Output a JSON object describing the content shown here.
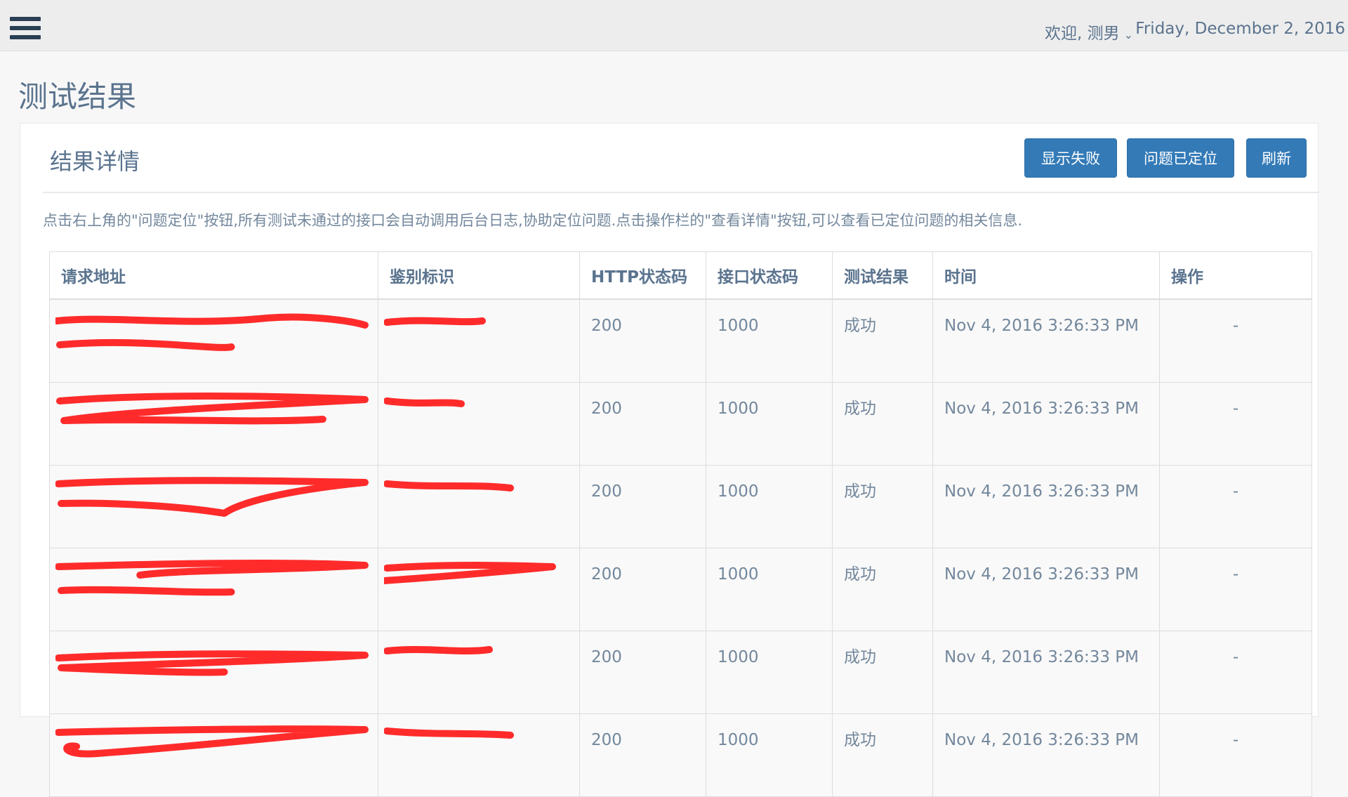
{
  "topbar": {
    "user_label": "欢迎, 测男",
    "date": "Friday, December 2, 2016"
  },
  "page_title": "测试结果",
  "panel": {
    "title": "结果详情",
    "buttons": {
      "show_failed": "显示失败",
      "issue_located": "问题已定位",
      "refresh": "刷新"
    },
    "instruction": "点击右上角的\"问题定位\"按钮,所有测试未通过的接口会自动调用后台日志,协助定位问题.点击操作栏的\"查看详情\"按钮,可以查看已定位问题的相关信息."
  },
  "table": {
    "headers": [
      "请求地址",
      "鉴别标识",
      "HTTP状态码",
      "接口状态码",
      "测试结果",
      "时间",
      "操作"
    ],
    "rows": [
      {
        "http": "200",
        "code": "1000",
        "result": "成功",
        "time": "Nov 4, 2016 3:26:33 PM",
        "op": "-"
      },
      {
        "http": "200",
        "code": "1000",
        "result": "成功",
        "time": "Nov 4, 2016 3:26:33 PM",
        "op": "-"
      },
      {
        "http": "200",
        "code": "1000",
        "result": "成功",
        "time": "Nov 4, 2016 3:26:33 PM",
        "op": "-"
      },
      {
        "http": "200",
        "code": "1000",
        "result": "成功",
        "time": "Nov 4, 2016 3:26:33 PM",
        "op": "-"
      },
      {
        "http": "200",
        "code": "1000",
        "result": "成功",
        "time": "Nov 4, 2016 3:26:33 PM",
        "op": "-"
      },
      {
        "http": "200",
        "code": "1000",
        "result": "成功",
        "time": "Nov 4, 2016 3:26:33 PM",
        "op": "-"
      }
    ]
  },
  "colors": {
    "primary_button": "#337ab7",
    "redaction": "#ff2b2b",
    "sidebar_dark": "#2a3f54"
  }
}
